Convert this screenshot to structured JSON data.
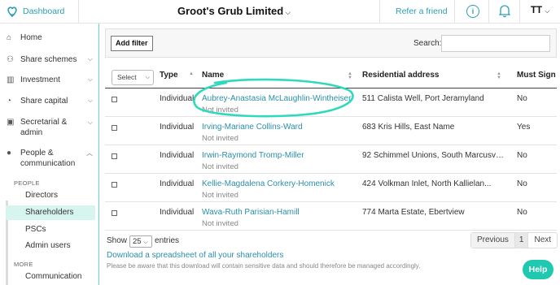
{
  "header": {
    "dashboard_label": "Dashboard",
    "company_name": "Groot's Grub Limited",
    "refer_label": "Refer a friend",
    "info_icon": "i",
    "user_initials": "TT",
    "brand_color": "#2a9fb1"
  },
  "sidebar": {
    "items": [
      {
        "label": "Home",
        "icon": "home-icon"
      },
      {
        "label": "Share schemes",
        "icon": "users-icon"
      },
      {
        "label": "Investment",
        "icon": "bank-icon"
      },
      {
        "label": "Share capital",
        "icon": "pie-chart-icon"
      },
      {
        "label": "Secretarial & admin",
        "icon": "briefcase-icon"
      },
      {
        "label": "People & communication",
        "icon": "person-icon"
      }
    ],
    "people_section": "PEOPLE",
    "people_items": [
      "Directors",
      "Shareholders",
      "PSCs",
      "Admin users"
    ],
    "more_section": "MORE",
    "more_items": [
      "Communication"
    ]
  },
  "filters": {
    "add_filter_label": "Add filter",
    "search_label": "Search:",
    "search_value": ""
  },
  "table": {
    "select_placeholder": "Select",
    "headers": {
      "type": "Type",
      "name": "Name",
      "address": "Residential address",
      "must_sign": "Must Sign"
    },
    "rows": [
      {
        "type": "Individual",
        "name": "Aubrey-Anastasia McLaughlin-Wintheiser",
        "status": "Not invited",
        "address": "511 Calista Well, Port Jeramyland",
        "must_sign": "No"
      },
      {
        "type": "Individual",
        "name": "Irving-Mariane Collins-Ward",
        "status": "Not invited",
        "address": "683 Kris Hills, East Name",
        "must_sign": "Yes"
      },
      {
        "type": "Individual",
        "name": "Irwin-Raymond Tromp-Miller",
        "status": "Not invited",
        "address": "92 Schimmel Unions, South Marcusvil...",
        "must_sign": "No"
      },
      {
        "type": "Individual",
        "name": "Kellie-Magdalena Corkery-Homenick",
        "status": "Not invited",
        "address": "424 Volkman Inlet, North Kallielan...",
        "must_sign": "No"
      },
      {
        "type": "Individual",
        "name": "Wava-Ruth Parisian-Hamill",
        "status": "Not invited",
        "address": "774 Marta Estate, Ebertview",
        "must_sign": "No"
      }
    ]
  },
  "footer": {
    "show_label": "Show",
    "page_length": "25",
    "entries_label": "entries",
    "prev_label": "Previous",
    "current_page": "1",
    "next_label": "Next",
    "download_link": "Download a spreadsheet of all your shareholders",
    "warning": "Please be aware that this download will contain sensitive data and should therefore be managed accordingly.",
    "help_label": "Help"
  }
}
